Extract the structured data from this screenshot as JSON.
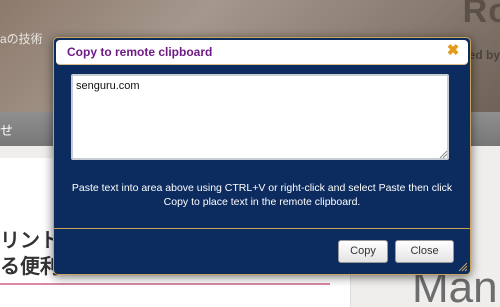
{
  "background": {
    "header_text": "aの技術",
    "brand": "Ro",
    "brand_sub": "Pseeuted by",
    "nav_text": "せ",
    "card_title": "リントす\nる便利",
    "right_text": "W\nMan"
  },
  "dialog": {
    "title": "Copy to remote clipboard",
    "close_icon": "close-icon",
    "close_glyph": "✖",
    "textarea_value": "senguru.com",
    "hint": "Paste text into area above using CTRL+V or right-click and select Paste then click Copy to place text in the remote clipboard.",
    "buttons": {
      "copy_label": "Copy",
      "close_label": "Close"
    }
  },
  "colors": {
    "dialog_bg": "#0c2b5e",
    "title_color": "#6e1b86",
    "close_color": "#e39a1b",
    "border_gold": "#c9a35a"
  }
}
